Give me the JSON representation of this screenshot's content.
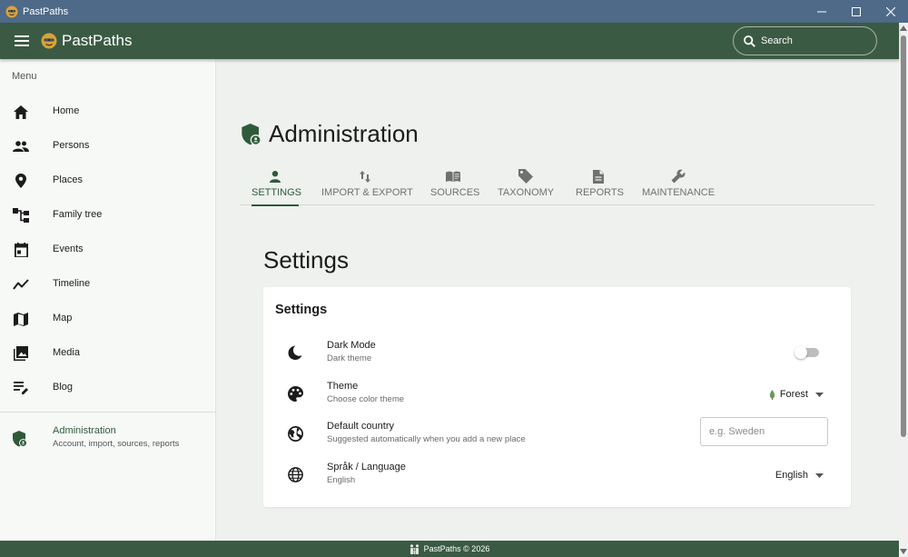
{
  "window": {
    "title": "PastPaths",
    "controls": [
      "minimize",
      "maximize",
      "close"
    ]
  },
  "appbar": {
    "app_name": "PastPaths",
    "search_placeholder": "Search"
  },
  "sidebar": {
    "header": "Menu",
    "items": [
      {
        "label": "Home",
        "icon": "home-icon"
      },
      {
        "label": "Persons",
        "icon": "people-icon"
      },
      {
        "label": "Places",
        "icon": "map-pin-icon"
      },
      {
        "label": "Family tree",
        "icon": "family-tree-icon"
      },
      {
        "label": "Events",
        "icon": "calendar-icon"
      },
      {
        "label": "Timeline",
        "icon": "timeline-icon"
      },
      {
        "label": "Map",
        "icon": "map-icon"
      },
      {
        "label": "Media",
        "icon": "media-icon"
      },
      {
        "label": "Blog",
        "icon": "blog-icon"
      }
    ],
    "admin": {
      "label": "Administration",
      "sub": "Account, import, sources, reports",
      "icon": "admin-shield-icon"
    }
  },
  "main": {
    "page_title": "Administration",
    "tabs": [
      {
        "label": "SETTINGS",
        "icon": "person-icon",
        "active": true
      },
      {
        "label": "IMPORT & EXPORT",
        "icon": "import-export-icon",
        "active": false
      },
      {
        "label": "SOURCES",
        "icon": "book-icon",
        "active": false
      },
      {
        "label": "TAXONOMY",
        "icon": "tag-icon",
        "active": false
      },
      {
        "label": "REPORTS",
        "icon": "report-icon",
        "active": false
      },
      {
        "label": "MAINTENANCE",
        "icon": "wrench-icon",
        "active": false
      }
    ],
    "section_title": "Settings",
    "card": {
      "title": "Settings",
      "dark_mode": {
        "label": "Dark Mode",
        "sub": "Dark theme",
        "enabled": false
      },
      "theme": {
        "label": "Theme",
        "sub": "Choose color theme",
        "value": "Forest"
      },
      "country": {
        "label": "Default country",
        "sub": "Suggested automatically when you add a new place",
        "value": "",
        "placeholder": "e.g. Sweden"
      },
      "language": {
        "label": "Språk / Language",
        "sub": "English",
        "value": "English"
      }
    }
  },
  "footer": {
    "text": "PastPaths © 2026"
  },
  "colors": {
    "primary": "#3b5a43",
    "accent": "#2f5a3a",
    "titlebar": "#4e6a88",
    "background": "#eef1ee"
  }
}
